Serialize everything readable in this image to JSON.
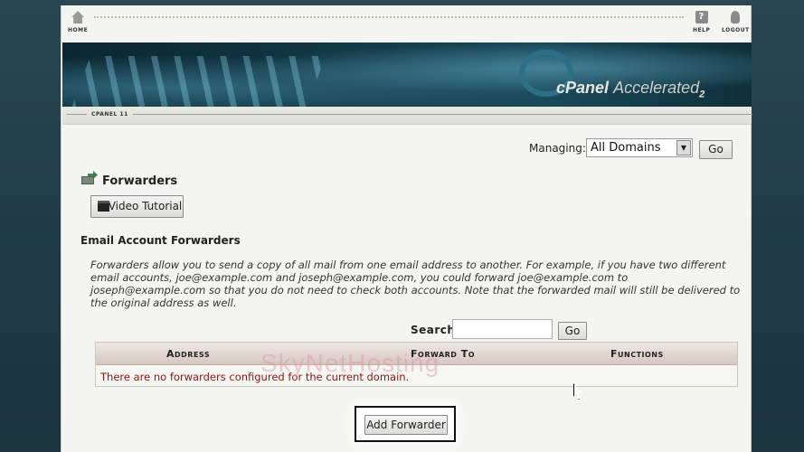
{
  "topbar": {
    "home_label": "HOME",
    "help_label": "HELP",
    "logout_label": "LOGOUT",
    "help_glyph": "?"
  },
  "banner": {
    "brand_primary": "cPanel",
    "brand_secondary": "Accelerated",
    "brand_sub": "2"
  },
  "version": "CPANEL 11",
  "managing": {
    "label": "Managing:",
    "selected": "All Domains",
    "go_label": "Go"
  },
  "page": {
    "title": "Forwarders",
    "video_button": "Video Tutorial",
    "section_title": "Email Account Forwarders",
    "description": "Forwarders allow you to send a copy of all mail from one email address to another. For example, if you have two different email accounts, joe@example.com and joseph@example.com, you could forward joe@example.com to joseph@example.com so that you do not need to check both accounts. Note that the forwarded mail will still be delivered to the original address as well."
  },
  "search": {
    "label": "Search",
    "value": "",
    "go_label": "Go"
  },
  "table": {
    "headers": [
      "Address",
      "Forward To",
      "Functions"
    ],
    "empty_message": "There are no forwarders configured for the current domain."
  },
  "actions": {
    "add_forwarder": "Add Forwarder"
  },
  "watermark": "SkyNetHosting",
  "colors": {
    "empty_message": "#8b1414",
    "highlight_border": "#111111"
  }
}
